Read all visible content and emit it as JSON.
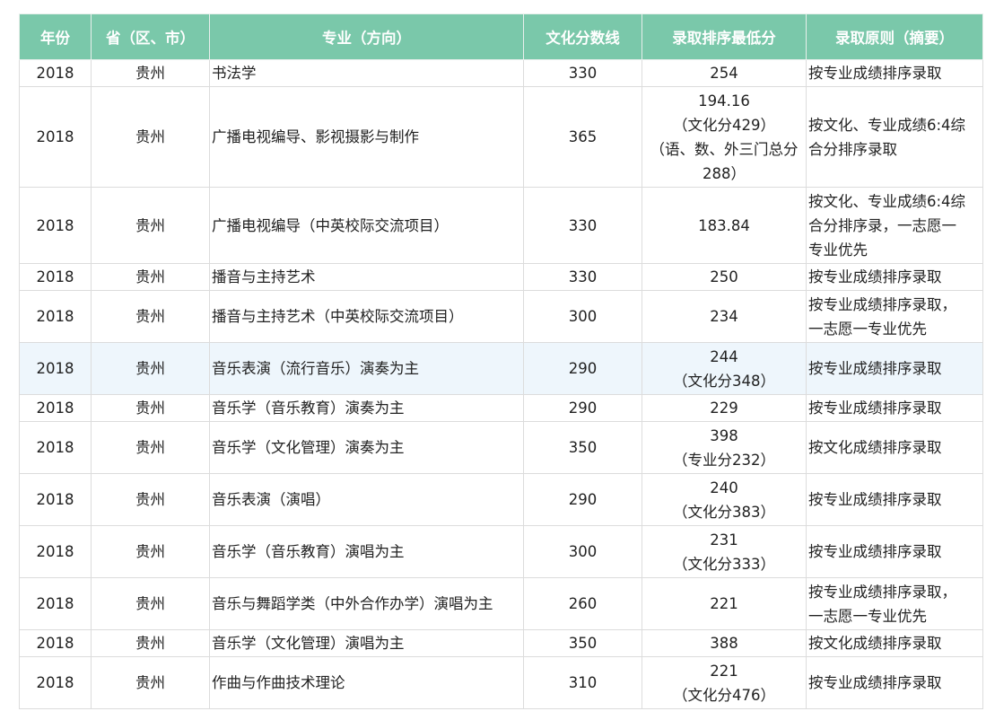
{
  "headers": [
    "年份",
    "省（区、市）",
    "专业（方向）",
    "文化分数线",
    "录取排序最低分",
    "录取原则（摘要）"
  ],
  "rows": [
    {
      "year": "2018",
      "prov": "贵州",
      "major": "书法学",
      "line": "330",
      "min": [
        "254"
      ],
      "rule": [
        "按专业成绩排序录取"
      ]
    },
    {
      "year": "2018",
      "prov": "贵州",
      "major": "广播电视编导、影视摄影与制作",
      "line": "365",
      "min": [
        "194.16",
        "（文化分429）",
        "（语、数、外三门总分",
        "288）"
      ],
      "rule": [
        "按文化、专业成绩6:4综",
        "合分排序录取"
      ]
    },
    {
      "year": "2018",
      "prov": "贵州",
      "major": "广播电视编导（中英校际交流项目）",
      "line": "330",
      "min": [
        "183.84"
      ],
      "rule": [
        "按文化、专业成绩6:4综",
        "合分排序录，一志愿一",
        "专业优先"
      ]
    },
    {
      "year": "2018",
      "prov": "贵州",
      "major": "播音与主持艺术",
      "line": "330",
      "min": [
        "250"
      ],
      "rule": [
        "按专业成绩排序录取"
      ]
    },
    {
      "year": "2018",
      "prov": "贵州",
      "major": "播音与主持艺术（中英校际交流项目）",
      "line": "300",
      "min": [
        "234"
      ],
      "rule": [
        "按专业成绩排序录取，",
        "一志愿一专业优先"
      ]
    },
    {
      "year": "2018",
      "prov": "贵州",
      "major": "音乐表演（流行音乐）演奏为主",
      "line": "290",
      "min": [
        "244",
        "（文化分348）"
      ],
      "rule": [
        "按专业成绩排序录取"
      ],
      "highlight": true
    },
    {
      "year": "2018",
      "prov": "贵州",
      "major": "音乐学（音乐教育）演奏为主",
      "line": "290",
      "min": [
        "229"
      ],
      "rule": [
        "按专业成绩排序录取"
      ]
    },
    {
      "year": "2018",
      "prov": "贵州",
      "major": "音乐学（文化管理）演奏为主",
      "line": "350",
      "min": [
        "398",
        "（专业分232）"
      ],
      "rule": [
        "按文化成绩排序录取"
      ]
    },
    {
      "year": "2018",
      "prov": "贵州",
      "major": "音乐表演（演唱）",
      "line": "290",
      "min": [
        "240",
        "（文化分383）"
      ],
      "rule": [
        "按专业成绩排序录取"
      ]
    },
    {
      "year": "2018",
      "prov": "贵州",
      "major": "音乐学（音乐教育）演唱为主",
      "line": "300",
      "min": [
        "231",
        "（文化分333）"
      ],
      "rule": [
        "按专业成绩排序录取"
      ]
    },
    {
      "year": "2018",
      "prov": "贵州",
      "major": "音乐与舞蹈学类（中外合作办学）演唱为主",
      "line": "260",
      "min": [
        "221"
      ],
      "rule": [
        "按专业成绩排序录取，",
        "一志愿一专业优先"
      ]
    },
    {
      "year": "2018",
      "prov": "贵州",
      "major": "音乐学（文化管理）演唱为主",
      "line": "350",
      "min": [
        "388"
      ],
      "rule": [
        "按文化成绩排序录取"
      ]
    },
    {
      "year": "2018",
      "prov": "贵州",
      "major": "作曲与作曲技术理论",
      "line": "310",
      "min": [
        "221",
        "（文化分476）"
      ],
      "rule": [
        "按专业成绩排序录取"
      ]
    }
  ]
}
